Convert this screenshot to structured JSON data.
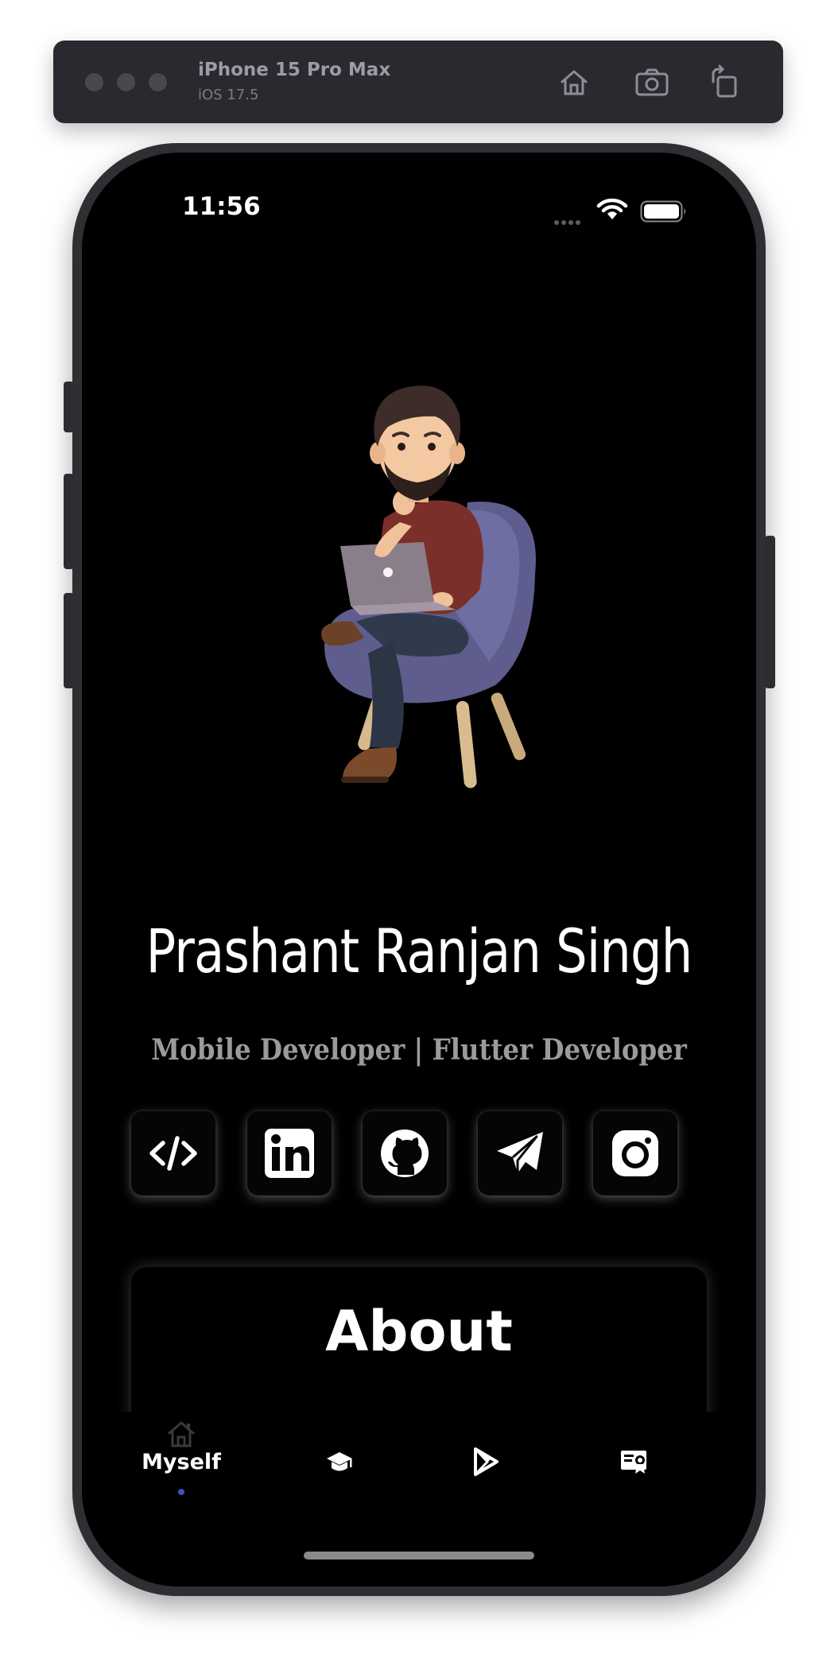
{
  "simulator": {
    "device_name": "iPhone 15 Pro Max",
    "os_version": "iOS 17.5",
    "toolbar_icons": [
      "home-icon",
      "screenshot-icon",
      "rotate-icon"
    ]
  },
  "status_bar": {
    "time": "11:56",
    "icons": [
      "signal-dots-icon",
      "wifi-icon",
      "battery-icon"
    ]
  },
  "profile": {
    "name": "Prashant Ranjan Singh",
    "role": "Mobile Developer | Flutter Developer",
    "avatar": "developer-on-chair-illustration"
  },
  "social_links": [
    {
      "icon": "code-icon"
    },
    {
      "icon": "linkedin-icon"
    },
    {
      "icon": "github-icon"
    },
    {
      "icon": "telegram-icon"
    },
    {
      "icon": "instagram-icon"
    }
  ],
  "about": {
    "title": "About"
  },
  "bottom_nav": {
    "items": [
      {
        "label": "Myself",
        "icon": "home-icon",
        "active": true
      },
      {
        "label": "",
        "icon": "graduation-cap-icon",
        "active": false
      },
      {
        "label": "",
        "icon": "play-store-icon",
        "active": false
      },
      {
        "label": "",
        "icon": "certificate-icon",
        "active": false
      }
    ],
    "active_color": "#3f51b5"
  },
  "colors": {
    "background": "#000000",
    "text_primary": "#ffffff",
    "text_secondary": "#9b9b9b"
  }
}
